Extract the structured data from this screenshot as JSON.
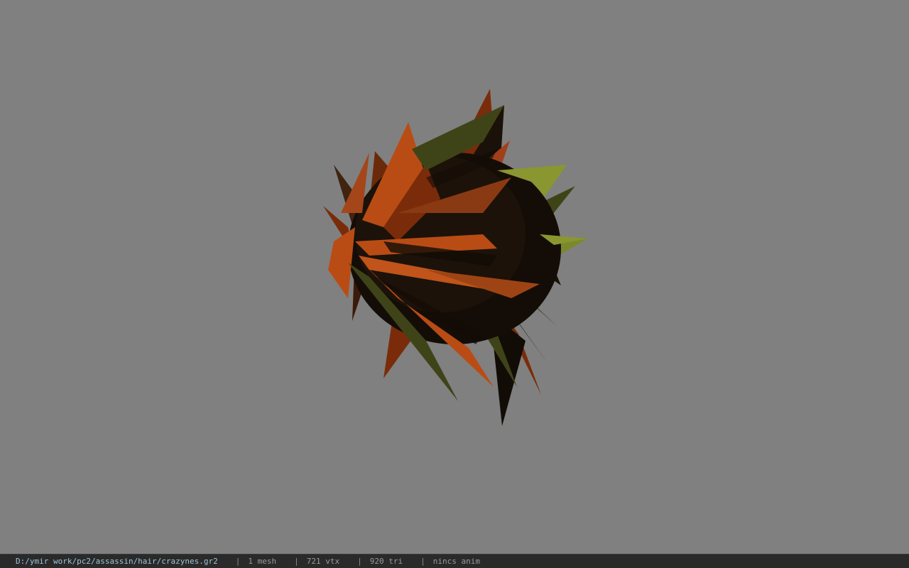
{
  "viewer": {
    "background_color": "#808080",
    "model_colors": {
      "orange": "#b94c14",
      "dark_orange": "#7a2c0a",
      "olive": "#3f4418",
      "light_olive": "#8a9630",
      "shadow": "#120c06"
    }
  },
  "status_bar": {
    "file_path": "D:/ymir work/pc2/assassin/hair/crazynes.gr2",
    "separator": "|",
    "mesh_count": "1 mesh",
    "vertex_count": "721 vtx",
    "triangle_count": "920 tri",
    "animation": "nincs anim"
  }
}
